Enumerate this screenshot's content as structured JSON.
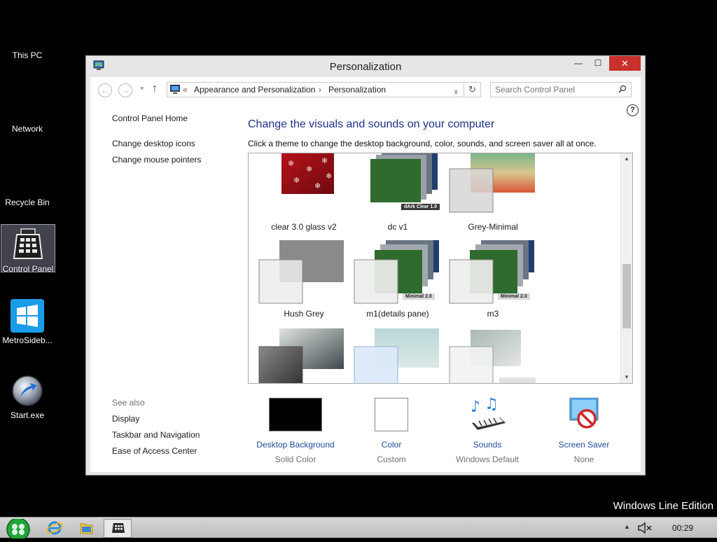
{
  "desktop": {
    "icons": [
      {
        "label": "This PC"
      },
      {
        "label": "Network"
      },
      {
        "label": "Recycle Bin"
      },
      {
        "label": "Control Panel"
      },
      {
        "label": "MetroSideb..."
      },
      {
        "label": "Start.exe"
      }
    ],
    "watermark": "Windows Line Edition"
  },
  "window": {
    "title": "Personalization",
    "controls": {
      "minimize": "—",
      "maximize": "☐",
      "close": "✕"
    },
    "address": {
      "prefix": "«",
      "crumbs": [
        "Appearance and Personalization",
        "Personalization"
      ],
      "separator": "›"
    },
    "search": {
      "placeholder": "Search Control Panel"
    },
    "help": "?",
    "left_pane": {
      "links": [
        "Control Panel Home",
        "Change desktop icons",
        "Change mouse pointers"
      ],
      "see_also_title": "See also",
      "see_also": [
        "Display",
        "Taskbar and Navigation",
        "Ease of Access Center"
      ]
    },
    "heading": "Change the visuals and sounds on your computer",
    "subtext": "Click a theme to change the desktop background, color, sounds, and screen saver all at once.",
    "themes": [
      {
        "name": "clear 3.0 glass v2"
      },
      {
        "name": "dc v1",
        "badge": "dArk Clear 1.0"
      },
      {
        "name": "Grey-Minimal"
      },
      {
        "name": "Hush Grey"
      },
      {
        "name": "m1(details pane)",
        "badge": "Minimal 2.0"
      },
      {
        "name": "m3",
        "badge": "Minimal 2.0"
      },
      {
        "name": ""
      },
      {
        "name": ""
      },
      {
        "name": ""
      }
    ],
    "settings": [
      {
        "label": "Desktop Background",
        "value": "Solid Color"
      },
      {
        "label": "Color",
        "value": "Custom"
      },
      {
        "label": "Sounds",
        "value": "Windows Default"
      },
      {
        "label": "Screen Saver",
        "value": "None"
      }
    ]
  },
  "taskbar": {
    "clock": "00:29",
    "tray_arrow": "▲"
  },
  "colors": {
    "close_button": "#c7302b",
    "heading": "#1e3287",
    "link": "#1e4d9a"
  }
}
